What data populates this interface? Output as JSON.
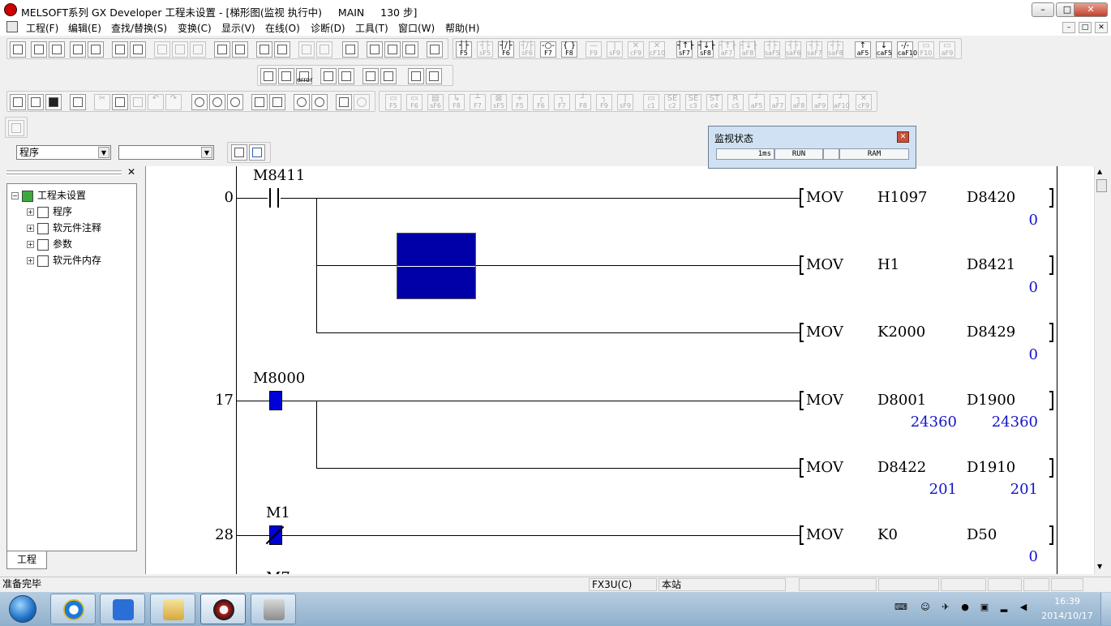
{
  "window": {
    "title": "MELSOFT系列 GX Developer 工程未设置 - [梯形图(监视 执行中)     MAIN     130 步]",
    "controls": {
      "minimize": "–",
      "restore": "□",
      "close": "✕"
    }
  },
  "menu": {
    "items": [
      "工程(F)",
      "编辑(E)",
      "查找/替换(S)",
      "变换(C)",
      "显示(V)",
      "在线(O)",
      "诊断(D)",
      "工具(T)",
      "窗口(W)",
      "帮助(H)"
    ],
    "mdi_controls": {
      "minimize": "–",
      "restore": "□",
      "close": "✕"
    }
  },
  "toolbar1_keys": [
    "F5",
    "sF5",
    "F6",
    "sF6",
    "F7",
    "F8",
    "F9",
    "sF9",
    "cF9",
    "cF10",
    "sF7",
    "sF8",
    "aF7",
    "aF8",
    "saF5",
    "saF6",
    "saF7",
    "saF8",
    "aF5",
    "caF5",
    "caF10",
    "F10",
    "aF9"
  ],
  "toolbar3_keys": [
    "F5",
    "F6",
    "sF6",
    "F8",
    "F7",
    "sF5",
    "F5",
    "F6",
    "F7",
    "F8",
    "F9",
    "sF9",
    "c1",
    "c2",
    "c3",
    "c4",
    "c5",
    "aF5",
    "aF7",
    "aF8",
    "aF9",
    "aF10",
    "cF9"
  ],
  "toolbar2_keys": {
    "error": "error"
  },
  "selectors": {
    "program_select": "程序",
    "second_select": ""
  },
  "project": {
    "root": "工程未设置",
    "items": [
      "程序",
      "软元件注释",
      "参数",
      "软元件内存"
    ],
    "tab": "工程",
    "close": "✕"
  },
  "ladder": {
    "rungs": [
      {
        "step": "0",
        "contact": "M8411"
      },
      {
        "step": "17",
        "contact": "M8000"
      },
      {
        "step": "28",
        "contact": "M1"
      }
    ],
    "instructions": [
      {
        "op": "MOV",
        "src": "H1097",
        "dst": "D8420",
        "src_val": "",
        "dst_val": "0"
      },
      {
        "op": "MOV",
        "src": "H1",
        "dst": "D8421",
        "src_val": "",
        "dst_val": "0"
      },
      {
        "op": "MOV",
        "src": "K2000",
        "dst": "D8429",
        "src_val": "",
        "dst_val": "0"
      },
      {
        "op": "MOV",
        "src": "D8001",
        "dst": "D1900",
        "src_val": "24360",
        "dst_val": "24360"
      },
      {
        "op": "MOV",
        "src": "D8422",
        "dst": "D1910",
        "src_val": "201",
        "dst_val": "201"
      },
      {
        "op": "MOV",
        "src": "K0",
        "dst": "D50",
        "src_val": "",
        "dst_val": "0"
      }
    ]
  },
  "monitor": {
    "title": "监视状态",
    "scan_time": "1ms",
    "run_status": "RUN",
    "memory": "RAM"
  },
  "status": {
    "ready": "准备完毕",
    "plc_type": "FX3U(C)",
    "station": "本站"
  },
  "taskbar": {
    "time": "16:39",
    "date": "2014/10/17"
  },
  "colors": {
    "monitor_on": "#0000d8",
    "monitor_value": "#1414c8",
    "cursor": "#0000a8"
  }
}
